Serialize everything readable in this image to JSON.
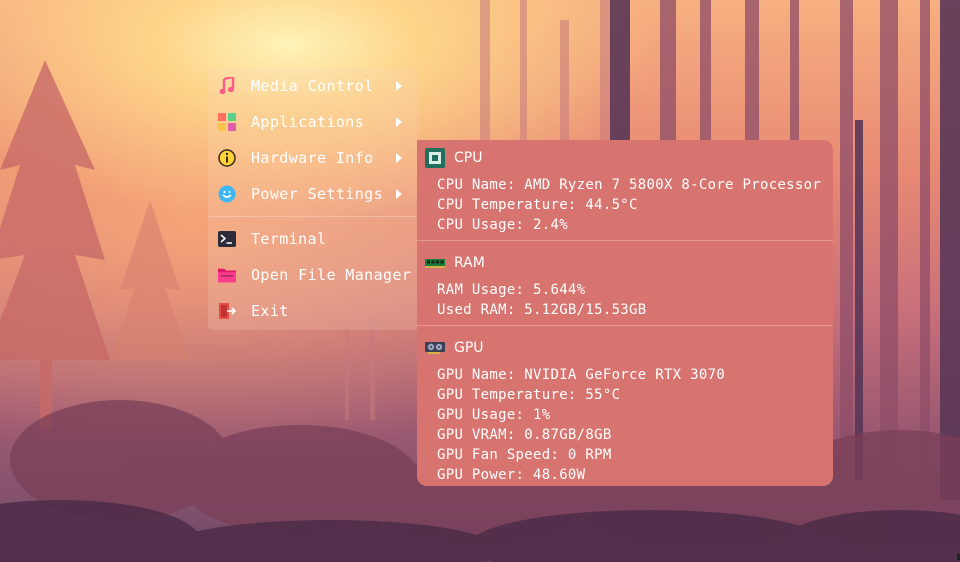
{
  "menu": {
    "items": [
      {
        "label": "Media Control",
        "icon": "music-note-icon",
        "has_submenu": true
      },
      {
        "label": "Applications",
        "icon": "app-grid-icon",
        "has_submenu": true
      },
      {
        "label": "Hardware Info",
        "icon": "info-icon",
        "has_submenu": true
      },
      {
        "label": "Power Settings",
        "icon": "power-smiley-icon",
        "has_submenu": true
      },
      {
        "label": "Terminal",
        "icon": "terminal-icon",
        "has_submenu": false
      },
      {
        "label": "Open File Manager",
        "icon": "folder-icon",
        "has_submenu": false
      },
      {
        "label": "Exit",
        "icon": "exit-icon",
        "has_submenu": false
      }
    ]
  },
  "hardware": {
    "cpu": {
      "title": "CPU",
      "icon": "cpu-chip-icon",
      "lines": [
        "CPU Name: AMD Ryzen 7 5800X 8-Core Processor",
        "CPU Temperature: 44.5°C",
        "CPU Usage: 2.4%"
      ]
    },
    "ram": {
      "title": "RAM",
      "icon": "ram-stick-icon",
      "lines": [
        "RAM Usage: 5.644%",
        "Used RAM: 5.12GB/15.53GB"
      ]
    },
    "gpu": {
      "title": "GPU",
      "icon": "graphics-card-icon",
      "lines": [
        "GPU Name: NVIDIA GeForce RTX 3070",
        "GPU Temperature: 55°C",
        "GPU Usage: 1%",
        "GPU VRAM: 0.87GB/8GB",
        "GPU Fan Speed: 0 RPM",
        "GPU Power: 48.60W"
      ]
    }
  },
  "colors": {
    "panel_bg": "#d87470",
    "text": "#ffffff"
  }
}
